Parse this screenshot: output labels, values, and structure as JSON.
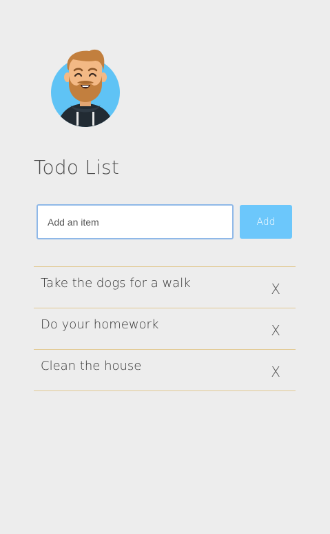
{
  "app": {
    "title": "Todo List"
  },
  "avatar": {
    "icon": "bearded-man-avatar-icon",
    "colors": {
      "background": "#5fc3f5",
      "skin": "#f3b985",
      "hair": "#c27f3e",
      "beard": "#c27f3e",
      "hoodie": "#222b33"
    }
  },
  "add_form": {
    "placeholder": "Add an item",
    "button_label": "Add",
    "button_color": "#6cc7fb"
  },
  "todos": [
    {
      "text": "Take the dogs for a walk",
      "delete_label": "X"
    },
    {
      "text": "Do your homework",
      "delete_label": "X"
    },
    {
      "text": "Clean the house",
      "delete_label": "X"
    }
  ]
}
